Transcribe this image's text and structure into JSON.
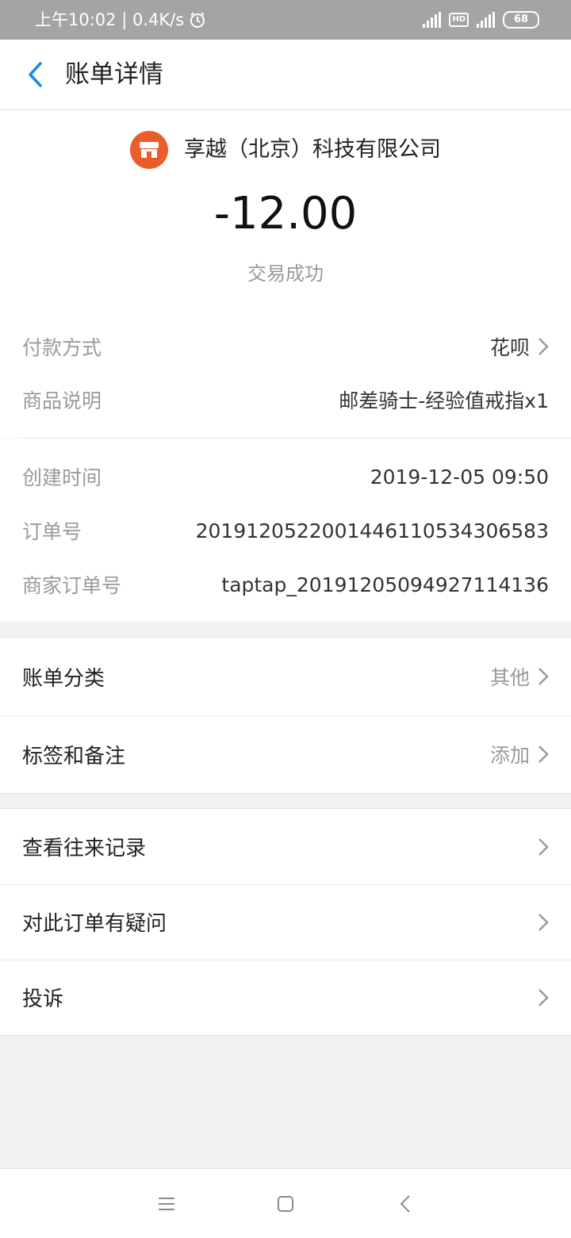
{
  "status_bar": {
    "time": "上午10:02 | 0.4K/s",
    "alarm_icon": "alarm-icon",
    "hd_label": "HD",
    "battery": "68"
  },
  "nav": {
    "title": "账单详情",
    "back_icon": "chevron-left-icon"
  },
  "header": {
    "merchant_name": "享越（北京）科技有限公司",
    "merchant_icon": "store-icon",
    "amount": "-12.00",
    "status": "交易成功",
    "accent_color": "#e85d28"
  },
  "details_top": [
    {
      "label": "付款方式",
      "value": "花呗"
    },
    {
      "label": "商品说明",
      "value": "邮差骑士-经验值戒指x1"
    }
  ],
  "details_bottom": [
    {
      "label": "创建时间",
      "value": "2019-12-05 09:50"
    },
    {
      "label": "订单号",
      "value": "2019120522001446110534306583"
    },
    {
      "label": "商家订单号",
      "value": "taptap_20191205094927114136"
    }
  ],
  "group1": [
    {
      "label": "账单分类",
      "value": "其他"
    },
    {
      "label": "标签和备注",
      "value": "添加"
    }
  ],
  "group2": [
    {
      "label": "查看往来记录"
    },
    {
      "label": "对此订单有疑问"
    },
    {
      "label": "投诉"
    }
  ],
  "system_nav": {
    "menu_icon": "menu-icon",
    "home_icon": "home-square-icon",
    "back_icon": "back-triangle-icon"
  },
  "colors": {
    "link_blue": "#1a8ae6",
    "page_bg": "#f2f2f4"
  }
}
